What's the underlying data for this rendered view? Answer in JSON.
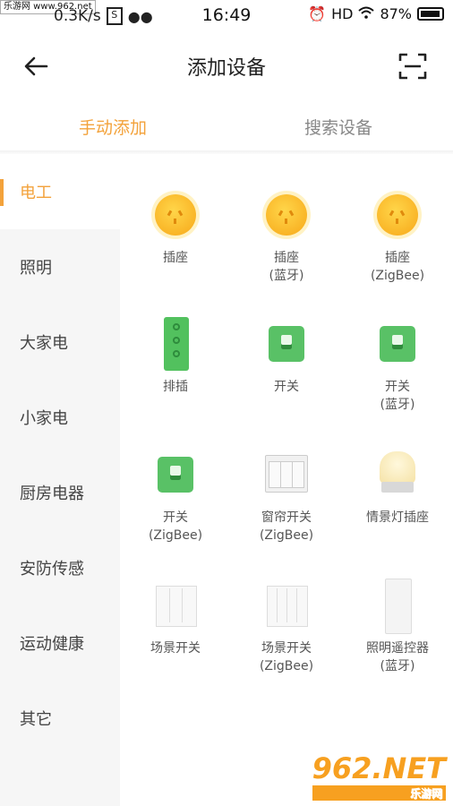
{
  "status_bar": {
    "watermark_badge": "乐游网 www.962.net",
    "network_speed": "0.3K/s",
    "time": "16:49",
    "hd": "HD",
    "battery": "87%"
  },
  "nav": {
    "title": "添加设备"
  },
  "tabs": [
    {
      "label": "手动添加"
    },
    {
      "label": "搜索设备"
    }
  ],
  "categories": [
    {
      "label": "电工"
    },
    {
      "label": "照明"
    },
    {
      "label": "大家电"
    },
    {
      "label": "小家电"
    },
    {
      "label": "厨房电器"
    },
    {
      "label": "安防传感"
    },
    {
      "label": "运动健康"
    },
    {
      "label": "其它"
    }
  ],
  "devices": [
    {
      "name": "插座",
      "sub": "",
      "icon": "socket-icon"
    },
    {
      "name": "插座",
      "sub": "(蓝牙)",
      "icon": "socket-icon"
    },
    {
      "name": "插座",
      "sub": "(ZigBee)",
      "icon": "socket-icon"
    },
    {
      "name": "排插",
      "sub": "",
      "icon": "power-strip-icon"
    },
    {
      "name": "开关",
      "sub": "",
      "icon": "switch-icon"
    },
    {
      "name": "开关",
      "sub": "(蓝牙)",
      "icon": "switch-icon"
    },
    {
      "name": "开关",
      "sub": "(ZigBee)",
      "icon": "switch-icon"
    },
    {
      "name": "窗帘开关",
      "sub": "(ZigBee)",
      "icon": "curtain-switch-icon"
    },
    {
      "name": "情景灯插座",
      "sub": "",
      "icon": "scene-lamp-icon"
    },
    {
      "name": "场景开关",
      "sub": "",
      "icon": "scene-switch-icon"
    },
    {
      "name": "场景开关",
      "sub": "(ZigBee)",
      "icon": "scene-switch-icon"
    },
    {
      "name": "照明遥控器",
      "sub": "(蓝牙)",
      "icon": "lighting-remote-icon"
    }
  ],
  "watermark": {
    "logo": "962.NET",
    "caption": "乐游网"
  },
  "colors": {
    "accent": "#f3a23b",
    "sidebar_bg": "#f6f6f6",
    "switch_green": "#59c166"
  }
}
